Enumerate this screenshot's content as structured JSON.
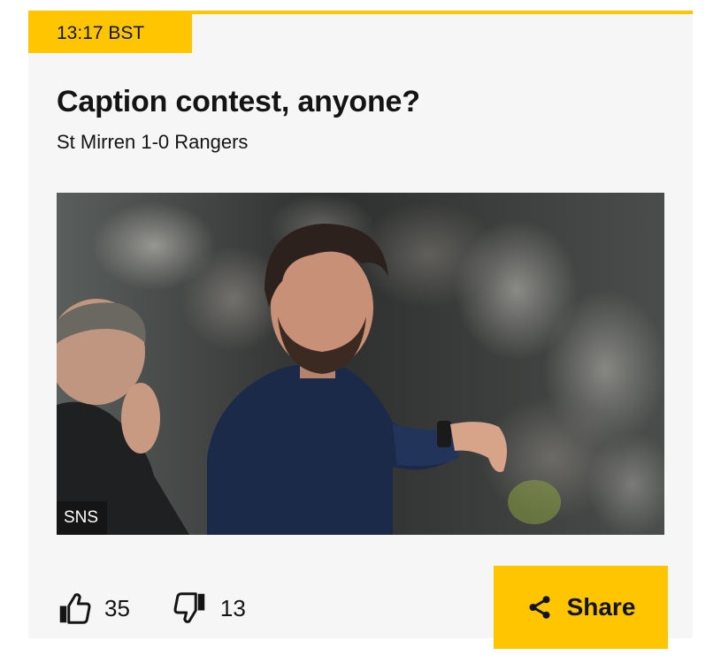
{
  "post": {
    "timestamp": "13:17 BST",
    "headline": "Caption contest, anyone?",
    "subline": "St Mirren 1-0 Rangers",
    "image": {
      "credit": "SNS"
    },
    "reactions": {
      "likes": "35",
      "dislikes": "13"
    },
    "share_label": "Share"
  },
  "colors": {
    "accent": "#ffc600",
    "card_background": "#f6f6f6",
    "text": "#141414"
  },
  "icons": {
    "like": "thumbs-up-icon",
    "dislike": "thumbs-down-icon",
    "share": "share-icon"
  }
}
